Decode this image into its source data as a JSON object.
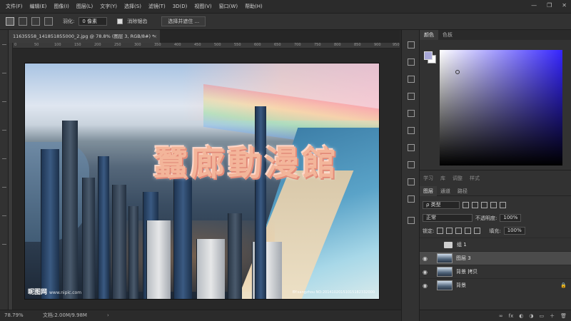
{
  "menu": {
    "items": [
      "文件(F)",
      "编辑(E)",
      "图像(I)",
      "图层(L)",
      "文字(Y)",
      "选择(S)",
      "滤镜(T)",
      "3D(D)",
      "视图(V)",
      "窗口(W)",
      "帮助(H)"
    ],
    "minimize": "—",
    "restore": "❐",
    "close": "✕"
  },
  "options": {
    "feather_label": "羽化:",
    "feather_value": "0 像素",
    "antialias_label": "消除锯齿",
    "select_mask_label": "选择并遮住 ..."
  },
  "document": {
    "tab_title": "11635558_141851855000_2.jpg @ 78.8% (图层 3, RGB/8#) *",
    "close": "×",
    "ruler_labels": [
      "0",
      "50",
      "100",
      "150",
      "200",
      "250",
      "300",
      "350",
      "400",
      "450",
      "500",
      "550",
      "600",
      "650",
      "700",
      "750",
      "800",
      "850",
      "900",
      "950"
    ]
  },
  "image": {
    "art_text": "蠶廊動漫館",
    "watermark_left": "昵图网",
    "watermark_left_sub": "www.nipic.com",
    "watermark_right": "BY:sangzhou  NO:20141020151015182332000"
  },
  "status": {
    "zoom": "78.79%",
    "doc_size": "文档:2.00M/9.98M",
    "arrow": "›"
  },
  "color_panel": {
    "tabs": [
      "颜色",
      "色板"
    ]
  },
  "layers_panel": {
    "top_tabs": [
      "学习",
      "库",
      "调整",
      "样式"
    ],
    "tabs": [
      "图层",
      "通道",
      "路径"
    ],
    "kind_filter": "ρ 类型",
    "blend_mode": "正常",
    "opacity_label": "不透明度:",
    "opacity_value": "100%",
    "lock_label": "锁定:",
    "fill_label": "填充:",
    "fill_value": "100%",
    "layers": [
      {
        "name": "组 1",
        "type": "group",
        "visible": false
      },
      {
        "name": "图层 3",
        "type": "layer",
        "visible": true,
        "selected": true
      },
      {
        "name": "背景 拷贝",
        "type": "layer",
        "visible": true
      },
      {
        "name": "背景",
        "type": "layer",
        "visible": true,
        "locked": true
      }
    ],
    "bottom_icons": [
      "∞",
      "fx",
      "◐",
      "◑",
      "▭",
      "＋",
      "🗑"
    ]
  },
  "colors": {
    "accent_picker": "#3525ff",
    "foreground_swatch": "#a8a8d8",
    "art_text": "#f3b59a"
  }
}
